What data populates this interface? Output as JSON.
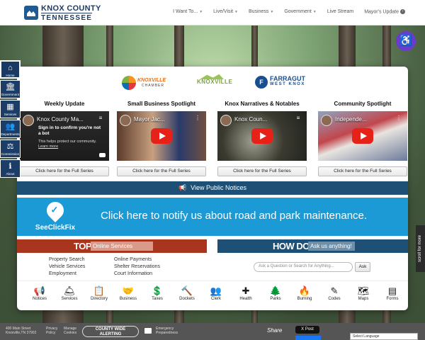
{
  "header": {
    "logo_line1": "KNOX COUNTY",
    "logo_line2": "TENNESSEE",
    "nav": [
      {
        "label": "I Want To...",
        "dropdown": true
      },
      {
        "label": "Live/Visit",
        "dropdown": true
      },
      {
        "label": "Business",
        "dropdown": true
      },
      {
        "label": "Government",
        "dropdown": true
      },
      {
        "label": "Live Stream",
        "dropdown": false
      },
      {
        "label": "Mayor's Update",
        "dropdown": false
      }
    ]
  },
  "sidebar": {
    "items": [
      {
        "label": "Home",
        "icon": "home-icon",
        "glyph": "⌂"
      },
      {
        "label": "Government",
        "icon": "building-icon",
        "glyph": "🏛"
      },
      {
        "label": "Services",
        "icon": "grid-icon",
        "glyph": "▦"
      },
      {
        "label": "Departments",
        "icon": "people-icon",
        "glyph": "👥"
      },
      {
        "label": "Commission",
        "icon": "gavel-icon",
        "glyph": "⚖"
      },
      {
        "label": "About",
        "icon": "info-icon",
        "glyph": "ℹ"
      }
    ]
  },
  "partners": {
    "knoxville_chamber_1": "KNOXVILLE",
    "knoxville_chamber_2": "CHAMBER",
    "tourism": "KNOXVILLE",
    "farragut_1": "FARRAGUT",
    "farragut_2": "WEST KNOX"
  },
  "videos": [
    {
      "title": "Weekly Update",
      "name": "Knox County Ma...",
      "signin_title": "Sign in to confirm you're not a bot",
      "signin_body": "This helps protect our community.",
      "signin_link": "Learn more",
      "button": "Click here for the Full Series"
    },
    {
      "title": "Small Business Spotlight",
      "name": "Mayor Jac...",
      "button": "Click here for the Full Series"
    },
    {
      "title": "Knox Narratives & Notables",
      "name": "Knox Coun...",
      "button": "Click here for the Full Series"
    },
    {
      "title": "Community Spotlight",
      "name": "Independe...",
      "button": "Click here for the Full Series"
    }
  ],
  "notices": {
    "label": "View Public Notices"
  },
  "seeclickfix": {
    "name": "SeeClickFix",
    "text": "Click here to notify us about road and park maintenance."
  },
  "top": {
    "label": "TOP",
    "pill": "Online Services",
    "links_col1": [
      "Property Search",
      "Vehicle Services",
      "Employment"
    ],
    "links_col2": [
      "Online Payments",
      "Shelter Reservations",
      "Court Information"
    ]
  },
  "howdoi": {
    "label": "HOW DO I",
    "pill": "Ask us anything!",
    "placeholder": "Ask a Question or Search for Anything...",
    "button": "Ask"
  },
  "quicklinks": [
    {
      "label": "Notices",
      "icon": "megaphone-icon",
      "glyph": "📢"
    },
    {
      "label": "Services",
      "icon": "bell-icon",
      "glyph": "🛎"
    },
    {
      "label": "Directory",
      "icon": "clipboard-icon",
      "glyph": "📋"
    },
    {
      "label": "Business",
      "icon": "handshake-icon",
      "glyph": "🤝"
    },
    {
      "label": "Taxes",
      "icon": "dollar-icon",
      "glyph": "💲"
    },
    {
      "label": "Dockets",
      "icon": "gavel-icon",
      "glyph": "🔨"
    },
    {
      "label": "Clerk",
      "icon": "users-icon",
      "glyph": "👥"
    },
    {
      "label": "Health",
      "icon": "medkit-icon",
      "glyph": "✚"
    },
    {
      "label": "Parks",
      "icon": "tree-icon",
      "glyph": "🌲"
    },
    {
      "label": "Burning",
      "icon": "fire-icon",
      "glyph": "🔥"
    },
    {
      "label": "Codes",
      "icon": "edit-icon",
      "glyph": "✎"
    },
    {
      "label": "Maps",
      "icon": "map-icon",
      "glyph": "🗺"
    },
    {
      "label": "Forms",
      "icon": "form-icon",
      "glyph": "▤"
    }
  ],
  "accessibility": {
    "glyph": "♿"
  },
  "scroll_more": "scroll for more",
  "footer": {
    "address1": "400 Main Street",
    "address2": "Knoxville,TN 37902",
    "privacy1": "Privacy",
    "privacy2": "Policy",
    "cookies1": "Manage",
    "cookies2": "Cookies",
    "alert1": "COUNTY WIDE",
    "alert2": "ALERTING",
    "prep1": "Emergency",
    "prep2": "Preparedness",
    "share": "Share",
    "xpost": "X Post",
    "language": "Select Language"
  }
}
